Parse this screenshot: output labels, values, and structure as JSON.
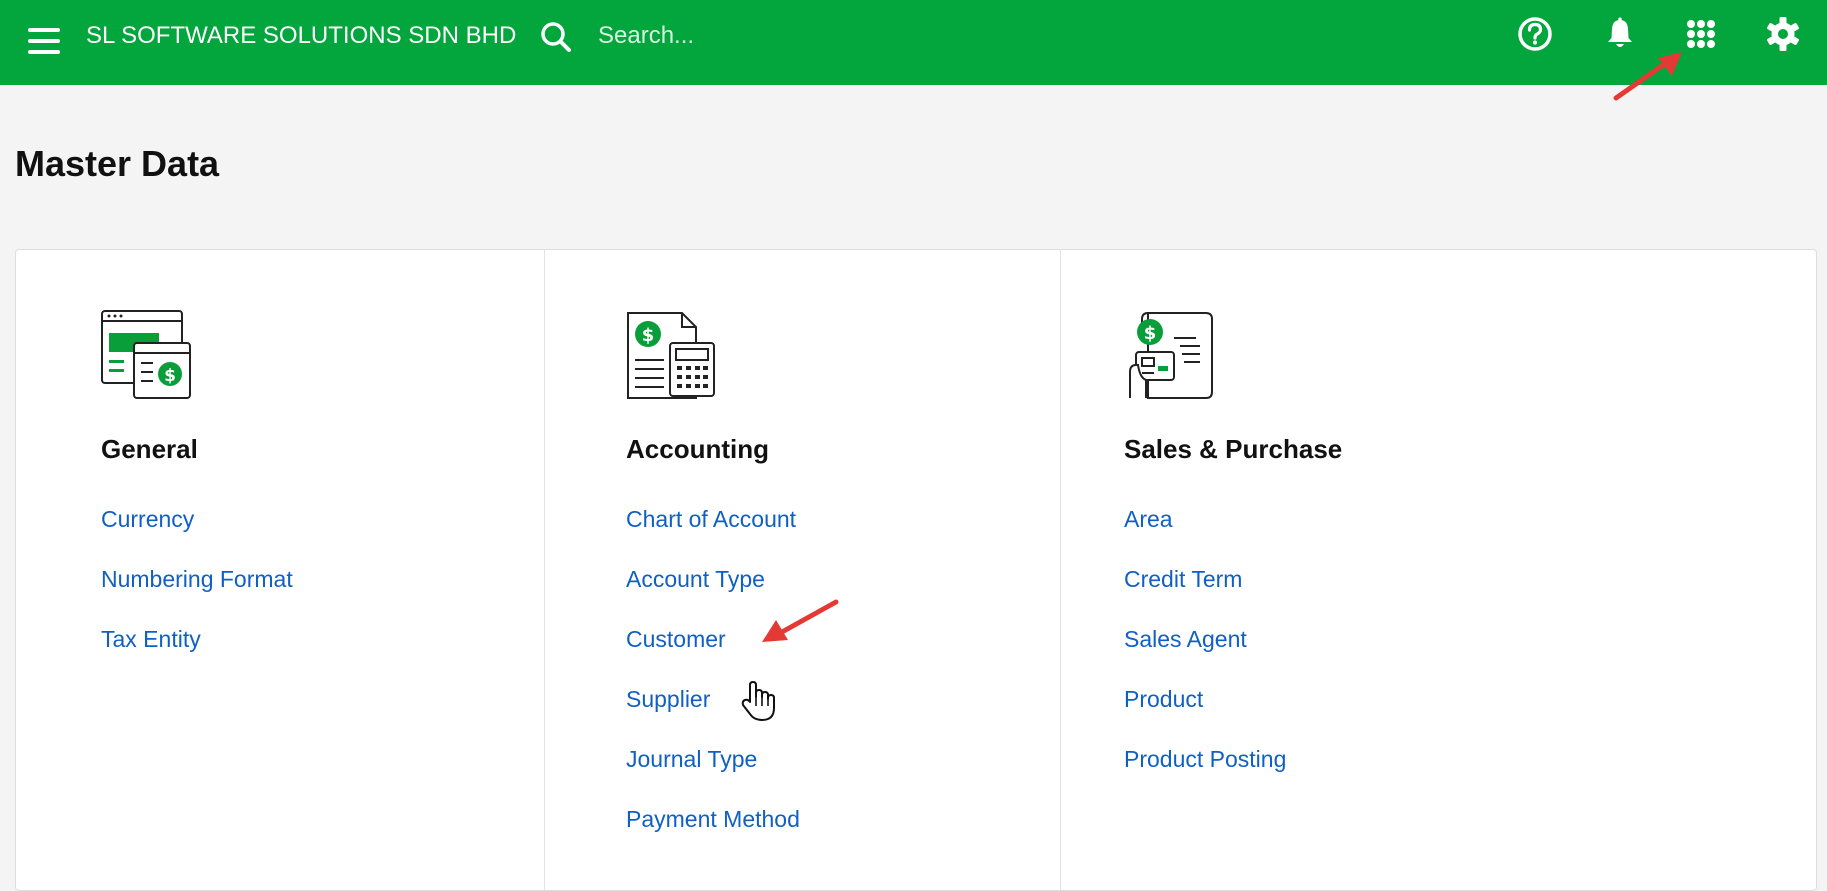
{
  "header": {
    "company_name": "SL SOFTWARE SOLUTIONS SDN BHD",
    "search_placeholder": "Search...",
    "icons": [
      "menu-icon",
      "search-icon",
      "help-icon",
      "bell-icon",
      "apps-grid-icon",
      "gear-icon"
    ]
  },
  "page": {
    "title": "Master Data"
  },
  "sections": {
    "general": {
      "title": "General",
      "icon": "general-settings-icon",
      "links": [
        "Currency",
        "Numbering Format",
        "Tax Entity"
      ]
    },
    "accounting": {
      "title": "Accounting",
      "icon": "accounting-calculator-icon",
      "links": [
        "Chart of Account",
        "Account Type",
        "Customer",
        "Supplier",
        "Journal Type",
        "Payment Method"
      ]
    },
    "sales": {
      "title": "Sales & Purchase",
      "icon": "sales-purchase-icon",
      "links": [
        "Area",
        "Credit Term",
        "Sales Agent",
        "Product",
        "Product Posting"
      ]
    }
  },
  "colors": {
    "header_bg": "#03a63c",
    "link": "#1060c4",
    "accent_green": "#0a9e3a",
    "annotation_arrow": "#e53935"
  },
  "annotations": [
    "red-arrow pointing to apps-grid-icon",
    "red-arrow pointing to Customer link",
    "hand-cursor over Supplier link"
  ]
}
